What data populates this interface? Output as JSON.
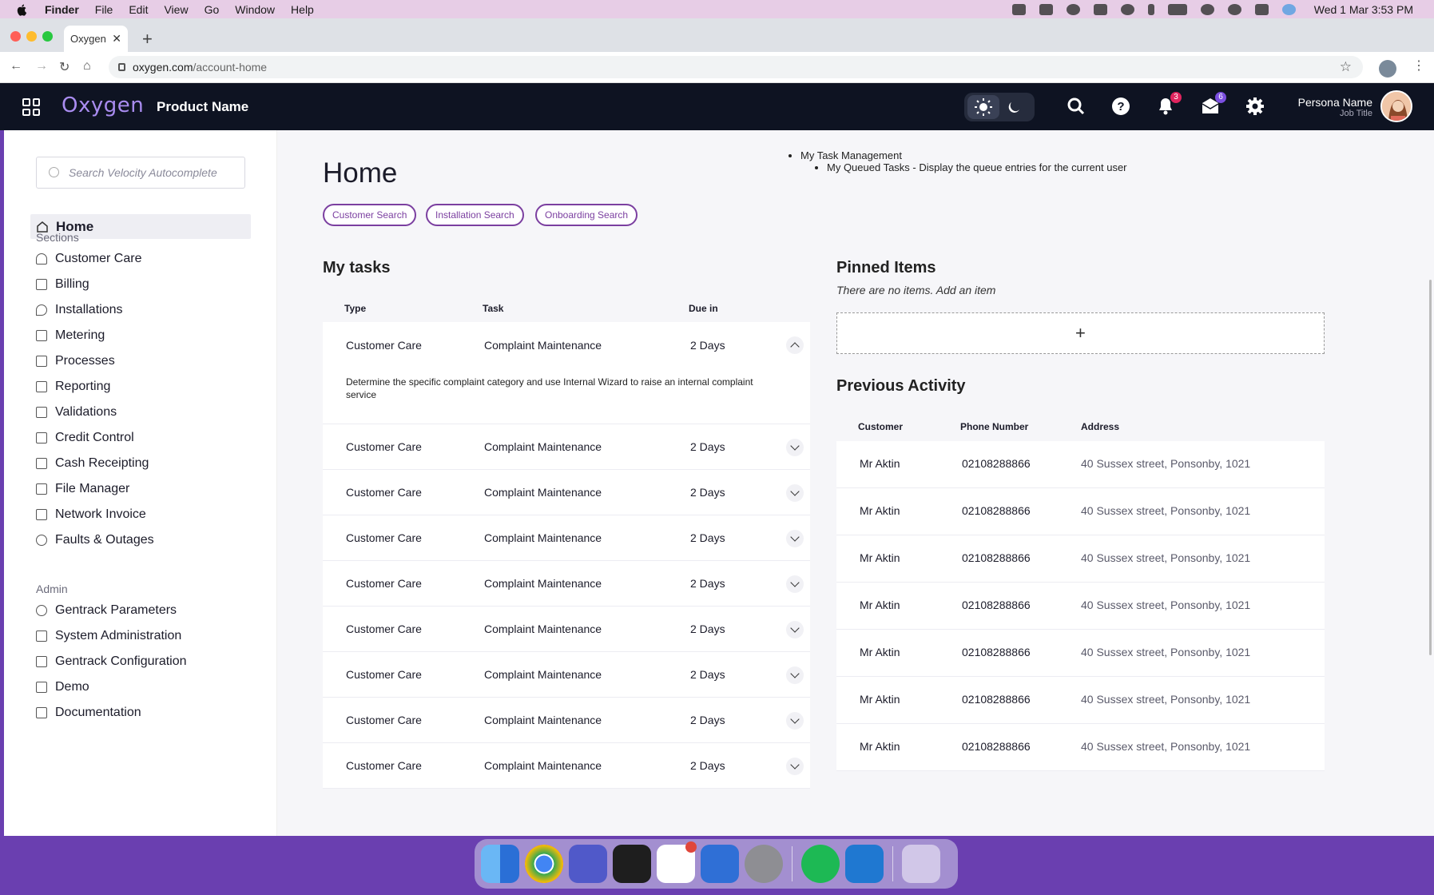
{
  "menubar": {
    "app": "Finder",
    "menus": [
      "File",
      "Edit",
      "View",
      "Go",
      "Window",
      "Help"
    ],
    "clock": "Wed 1 Mar  3:53 PM"
  },
  "browser": {
    "tab_title": "Oxygen",
    "url_host": "oxygen.com",
    "url_path": "/account-home"
  },
  "header": {
    "logo": "Oxygen",
    "product": "Product Name",
    "notifications_count": "3",
    "messages_count": "6",
    "persona_name": "Persona Name",
    "persona_title": "Job Title",
    "accent": "#a98cf0"
  },
  "sidebar": {
    "search_placeholder": "Search Velocity Autocomplete",
    "home": "Home",
    "sections_heading": "Sections",
    "sections": [
      {
        "label": "Customer Care",
        "icon": "user-icon"
      },
      {
        "label": "Billing",
        "icon": "wallet-icon"
      },
      {
        "label": "Installations",
        "icon": "location-icon"
      },
      {
        "label": "Metering",
        "icon": "meter-icon"
      },
      {
        "label": "Processes",
        "icon": "hourglass-icon"
      },
      {
        "label": "Reporting",
        "icon": "report-icon"
      },
      {
        "label": "Validations",
        "icon": "validation-icon"
      },
      {
        "label": "Credit Control",
        "icon": "card-icon"
      },
      {
        "label": "Cash Receipting",
        "icon": "receipt-icon"
      },
      {
        "label": "File Manager",
        "icon": "folder-icon"
      },
      {
        "label": "Network Invoice",
        "icon": "invoice-icon"
      },
      {
        "label": "Faults & Outages",
        "icon": "alert-icon"
      }
    ],
    "admin_heading": "Admin",
    "admin": [
      {
        "label": "Gentrack Parameters",
        "icon": "gear-icon"
      },
      {
        "label": "System Administration",
        "icon": "admin-icon"
      },
      {
        "label": "Gentrack Configuration",
        "icon": "config-icon"
      },
      {
        "label": "Demo",
        "icon": "demo-icon"
      },
      {
        "label": "Documentation",
        "icon": "docs-icon"
      }
    ]
  },
  "main": {
    "title": "Home",
    "quick_links": [
      "Customer Search",
      "Installation Search",
      "Onboarding Search"
    ],
    "notes": {
      "item": "My Task Management",
      "subitem": "My Queued Tasks - Display the queue entries for the current user"
    },
    "tasks": {
      "heading": "My tasks",
      "columns": [
        "Type",
        "Task",
        "Due in"
      ],
      "expanded_detail": "Determine the specific complaint category and use Internal Wizard to raise an internal complaint service",
      "rows": [
        {
          "type": "Customer Care",
          "task": "Complaint Maintenance",
          "due": "2 Days"
        },
        {
          "type": "Customer Care",
          "task": "Complaint Maintenance",
          "due": "2 Days"
        },
        {
          "type": "Customer Care",
          "task": "Complaint Maintenance",
          "due": "2 Days"
        },
        {
          "type": "Customer Care",
          "task": "Complaint Maintenance",
          "due": "2 Days"
        },
        {
          "type": "Customer Care",
          "task": "Complaint Maintenance",
          "due": "2 Days"
        },
        {
          "type": "Customer Care",
          "task": "Complaint Maintenance",
          "due": "2 Days"
        },
        {
          "type": "Customer Care",
          "task": "Complaint Maintenance",
          "due": "2 Days"
        },
        {
          "type": "Customer Care",
          "task": "Complaint Maintenance",
          "due": "2 Days"
        },
        {
          "type": "Customer Care",
          "task": "Complaint Maintenance",
          "due": "2 Days"
        }
      ]
    },
    "pinned": {
      "heading": "Pinned Items",
      "empty": "There are no items. Add an item"
    },
    "activity": {
      "heading": "Previous Activity",
      "columns": [
        "Customer",
        "Phone Number",
        "Address"
      ],
      "rows": [
        {
          "customer": "Mr Aktin",
          "phone": "02108288866",
          "address": "40 Sussex street, Ponsonby, 1021"
        },
        {
          "customer": "Mr Aktin",
          "phone": "02108288866",
          "address": "40 Sussex street, Ponsonby, 1021"
        },
        {
          "customer": "Mr Aktin",
          "phone": "02108288866",
          "address": "40 Sussex street, Ponsonby, 1021"
        },
        {
          "customer": "Mr Aktin",
          "phone": "02108288866",
          "address": "40 Sussex street, Ponsonby, 1021"
        },
        {
          "customer": "Mr Aktin",
          "phone": "02108288866",
          "address": "40 Sussex street, Ponsonby, 1021"
        },
        {
          "customer": "Mr Aktin",
          "phone": "02108288866",
          "address": "40 Sussex street, Ponsonby, 1021"
        },
        {
          "customer": "Mr Aktin",
          "phone": "02108288866",
          "address": "40 Sussex street, Ponsonby, 1021"
        }
      ]
    }
  },
  "dock": [
    "finder-icon",
    "chrome-icon",
    "teams-icon",
    "figma-icon",
    "slack-icon",
    "vpn-icon",
    "settings-icon",
    "spotify-icon",
    "vscode-icon",
    "trash-icon"
  ]
}
